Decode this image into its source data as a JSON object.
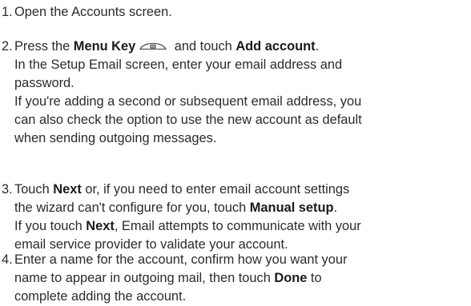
{
  "steps": [
    {
      "number": "1.",
      "lines": [
        {
          "text": "Open the Accounts screen."
        }
      ]
    },
    {
      "number": "2.",
      "lines": [
        {
          "pre": "Press the ",
          "bold1": "Menu Key",
          "mid": " and touch ",
          "bold2": "Add account",
          "post": "."
        },
        {
          "text": "In the Setup Email screen, enter your email address and"
        },
        {
          "text": "password."
        },
        {
          "text": "If you're adding a second or subsequent email address, you"
        },
        {
          "text": "can also check the option to use the new account as default"
        },
        {
          "text": "when sending outgoing messages."
        }
      ]
    },
    {
      "number": "3.",
      "lines": [
        {
          "pre": "Touch ",
          "bold1": "Next",
          "post": " or, if you need to enter email account settings"
        },
        {
          "pre": "the wizard can't configure for you, touch ",
          "bold1": "Manual setup",
          "post": "."
        },
        {
          "pre": "If you touch ",
          "bold1": "Next",
          "post": ", Email attempts to communicate with your"
        },
        {
          "text": "email service provider to validate your account."
        }
      ]
    },
    {
      "number": "4.",
      "lines": [
        {
          "text": "Enter a name for the account, confirm how you want your"
        },
        {
          "pre": "name to appear in outgoing mail, then touch ",
          "bold1": "Done",
          "post": " to"
        },
        {
          "text": "complete adding the account."
        }
      ]
    }
  ],
  "icons": {
    "menu_key": "menu-key-icon"
  }
}
